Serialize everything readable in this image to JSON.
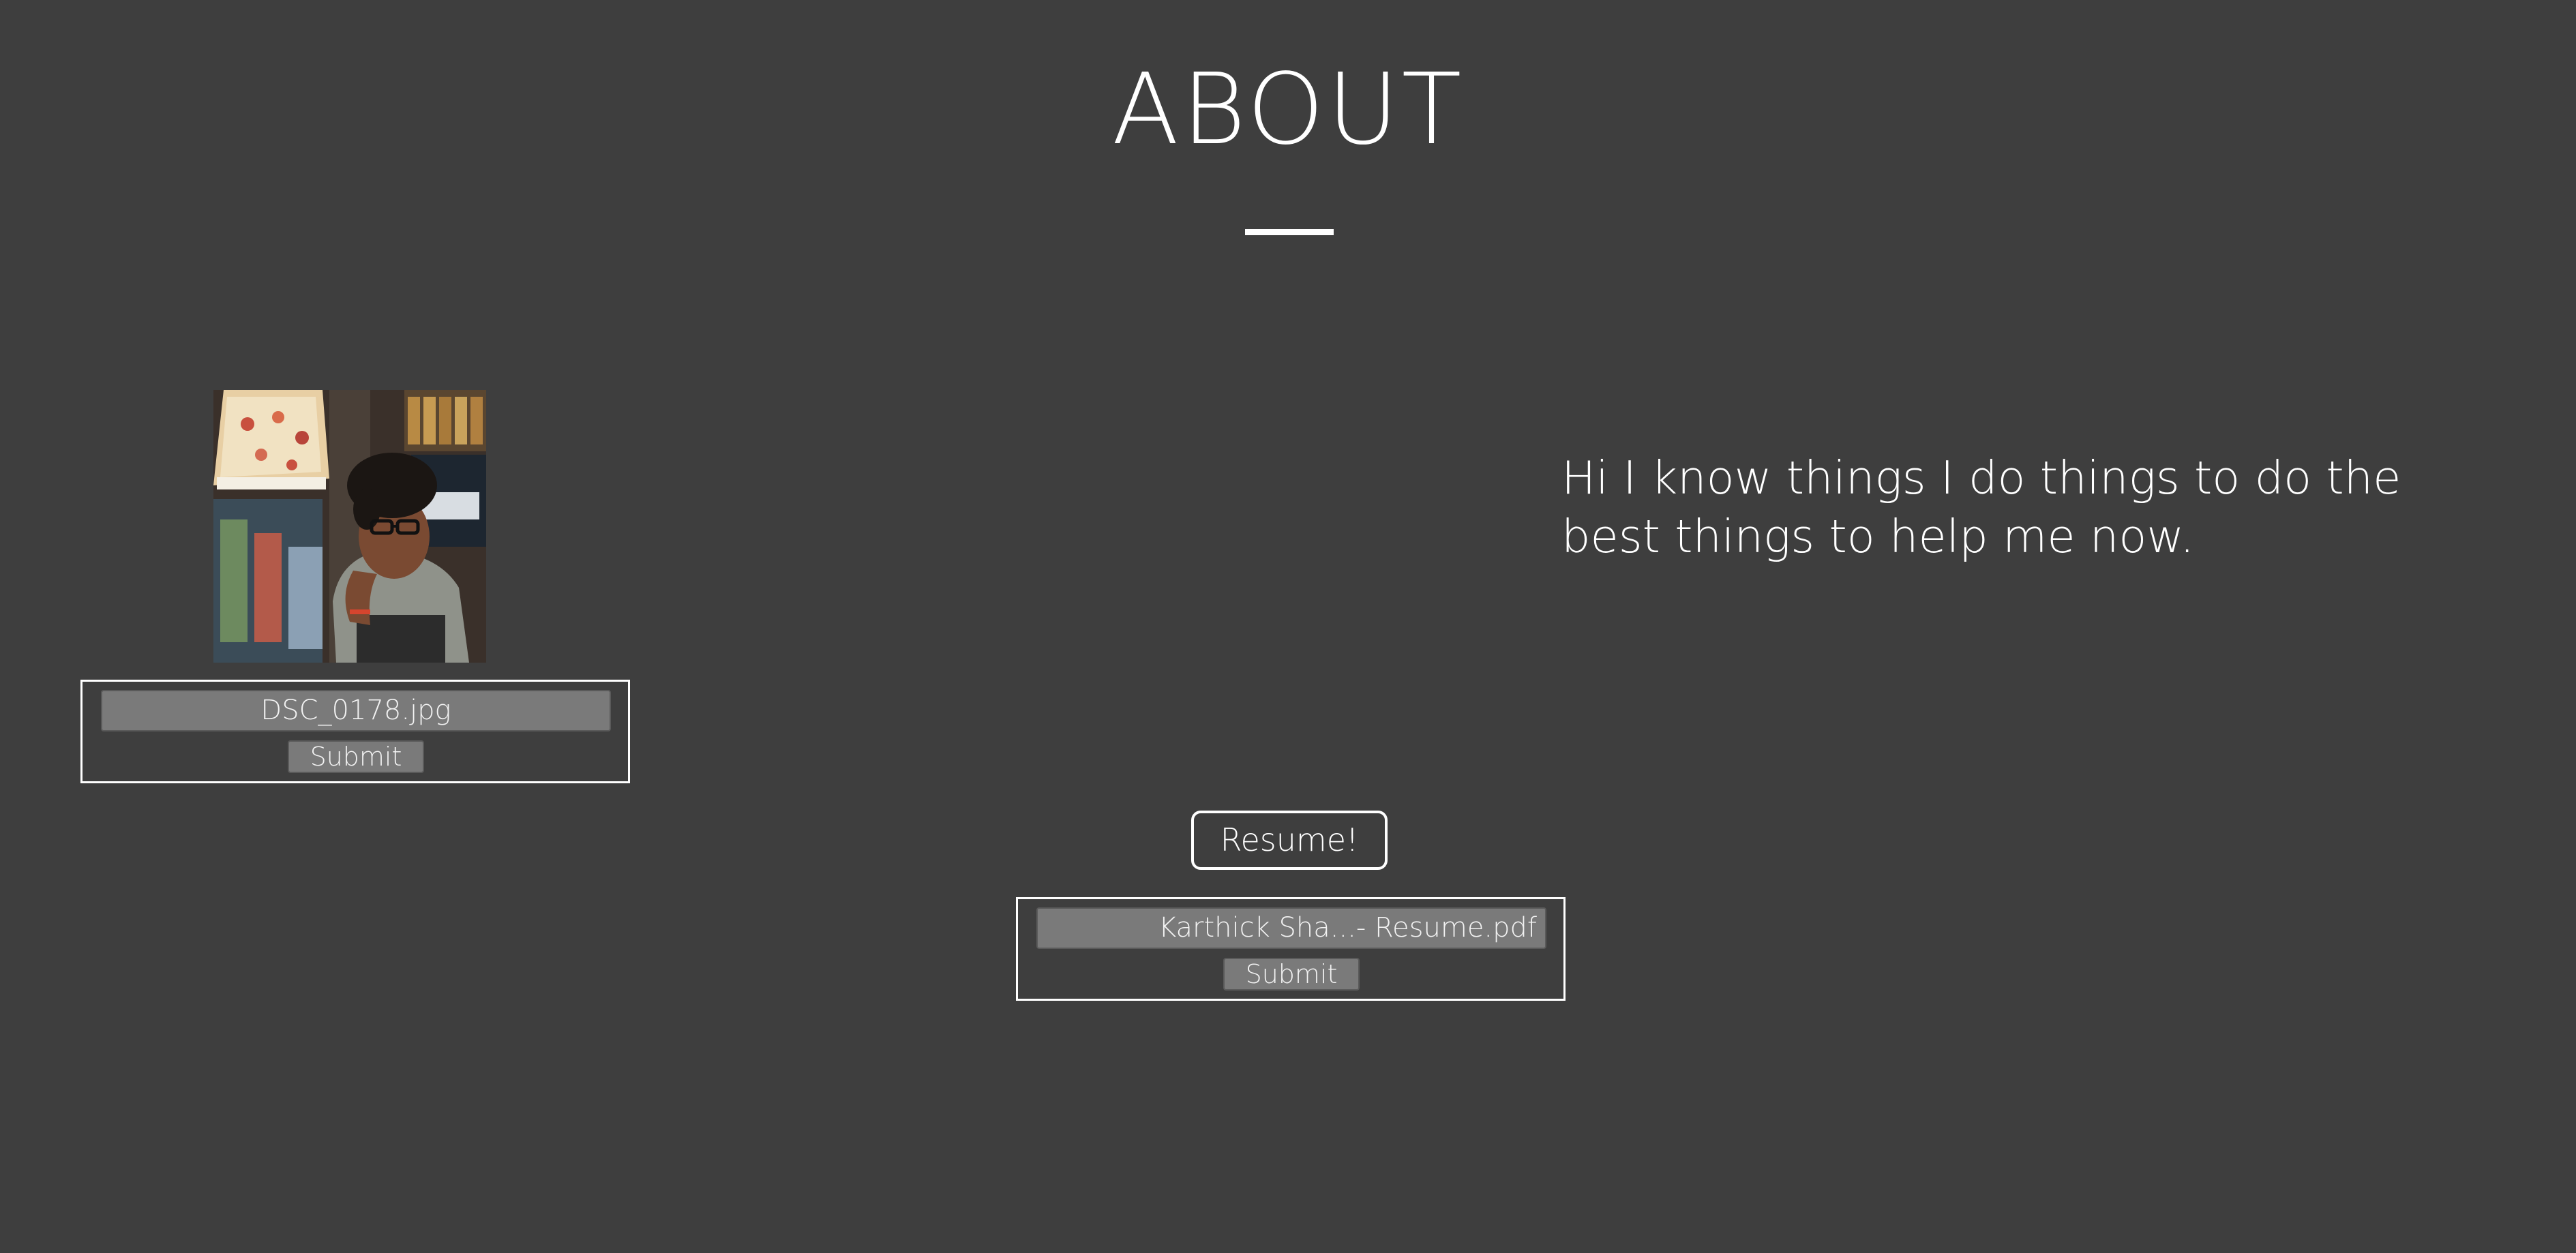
{
  "header": {
    "title": "ABOUT"
  },
  "profile": {
    "photo_alt": "profile photo",
    "photo_upload": {
      "file_name": "DSC_0178.jpg",
      "submit_label": "Submit"
    }
  },
  "about": {
    "text": "Hi I know things I do things to do the best things to help me now."
  },
  "resume": {
    "button_label": "Resume!",
    "upload": {
      "file_name": "Karthick Sha...- Resume.pdf",
      "submit_label": "Submit"
    }
  },
  "colors": {
    "background": "#3e3e3e",
    "text": "#ffffff",
    "input_fill": "#7a7a7a"
  }
}
